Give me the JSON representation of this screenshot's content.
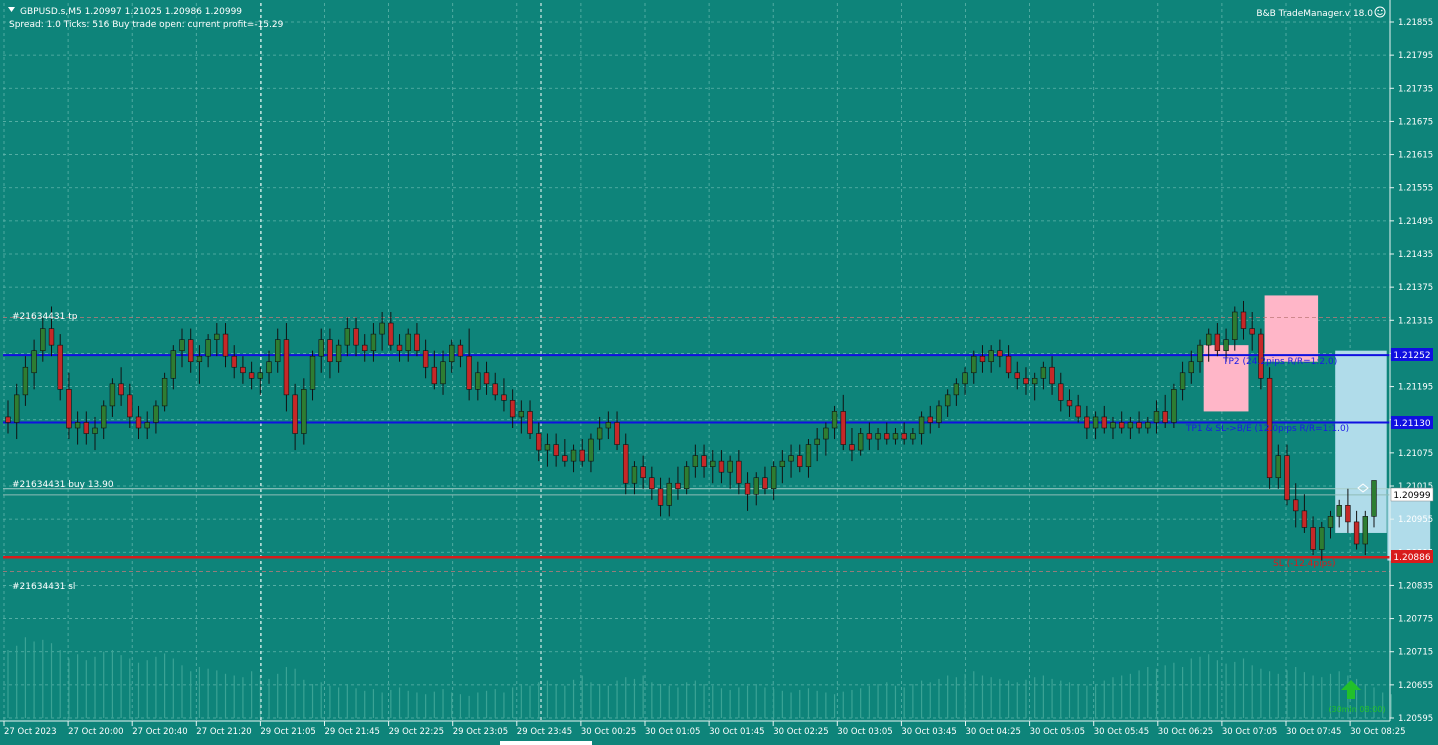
{
  "header": {
    "symbol_line": "GBPUSD.s,M5  1.20997 1.21025 1.20986 1.20999",
    "info_line": "Spread: 1.0   Ticks: 516   Buy trade open: current profit=-15.29",
    "brand": "B&B TradeManager.v 18.0"
  },
  "labels": {
    "tp": "#21634431 tp",
    "buy": "#21634431 buy 13.90",
    "sl": "#21634431 sl",
    "tp2_text": "TP2 (24.2pips R/R=1:2.0)",
    "tp1_text": "TP1 & SL->B/E (12.0pips R/R=1:1.0)",
    "sl_text": "SL (-12.4pips)",
    "countdown": "(30min 08:00)"
  },
  "colors": {
    "background": "#0e847a",
    "grid": "#5fb4ab",
    "bull": "#2e7d32",
    "bear": "#c62828",
    "tp_line": "#1010e0",
    "sl_line": "#d81b1b",
    "volume": "#3ba395",
    "pink_zone": "#ffb6c8",
    "blue_zone": "#b0dcea",
    "arrow": "#22c02a"
  },
  "chart_data": {
    "type": "candlestick",
    "symbol": "GBPUSD.s",
    "timeframe": "M5",
    "ohlc": [
      1.20997,
      1.21025,
      1.20986,
      1.20999
    ],
    "y_ticks": [
      1.21855,
      1.21795,
      1.21735,
      1.21675,
      1.21615,
      1.21555,
      1.21495,
      1.21435,
      1.21375,
      1.21315,
      1.21255,
      1.21195,
      1.21135,
      1.21075,
      1.21015,
      1.20955,
      1.20895,
      1.20835,
      1.20775,
      1.20715,
      1.20655,
      1.20595
    ],
    "x_labels": [
      "27 Oct 2023",
      "27 Oct 20:00",
      "27 Oct 20:40",
      "27 Oct 21:20",
      "29 Oct 21:05",
      "29 Oct 21:45",
      "29 Oct 22:25",
      "29 Oct 23:05",
      "29 Oct 23:45",
      "30 Oct 00:25",
      "30 Oct 01:05",
      "30 Oct 01:45",
      "30 Oct 02:25",
      "30 Oct 03:05",
      "30 Oct 03:45",
      "30 Oct 04:25",
      "30 Oct 05:05",
      "30 Oct 05:45",
      "30 Oct 06:25",
      "30 Oct 07:05",
      "30 Oct 07:45",
      "30 Oct 08:25"
    ],
    "ylim": [
      1.20585,
      1.21885
    ],
    "grid": true,
    "levels": {
      "tp2": {
        "price": "1.21252",
        "value": 1.21252
      },
      "tp1": {
        "price": "1.21130",
        "value": 1.2113
      },
      "bid": {
        "price": "1.20999",
        "value": 1.20999
      },
      "sl": {
        "price": "1.20886",
        "value": 1.20886
      }
    },
    "candles": [
      [
        1.2114,
        1.2117,
        1.2111,
        1.2113
      ],
      [
        1.2113,
        1.212,
        1.211,
        1.2118
      ],
      [
        1.2118,
        1.2125,
        1.2116,
        1.2123
      ],
      [
        1.2122,
        1.2128,
        1.2119,
        1.2126
      ],
      [
        1.2126,
        1.2132,
        1.2124,
        1.213
      ],
      [
        1.213,
        1.2134,
        1.2125,
        1.2127
      ],
      [
        1.2127,
        1.2129,
        1.2117,
        1.2119
      ],
      [
        1.2119,
        1.2122,
        1.211,
        1.2112
      ],
      [
        1.2112,
        1.2115,
        1.2109,
        1.2113
      ],
      [
        1.2113,
        1.2115,
        1.2109,
        1.2111
      ],
      [
        1.2111,
        1.2114,
        1.2108,
        1.2112
      ],
      [
        1.2112,
        1.2117,
        1.211,
        1.2116
      ],
      [
        1.2116,
        1.2121,
        1.2114,
        1.212
      ],
      [
        1.212,
        1.2123,
        1.2116,
        1.2118
      ],
      [
        1.2118,
        1.212,
        1.2112,
        1.2114
      ],
      [
        1.2114,
        1.2116,
        1.211,
        1.2112
      ],
      [
        1.2112,
        1.2115,
        1.211,
        1.2113
      ],
      [
        1.2113,
        1.2117,
        1.2111,
        1.2116
      ],
      [
        1.2116,
        1.2122,
        1.2115,
        1.2121
      ],
      [
        1.2121,
        1.2127,
        1.2119,
        1.2126
      ],
      [
        1.2126,
        1.213,
        1.2123,
        1.2128
      ],
      [
        1.2128,
        1.213,
        1.2122,
        1.2124
      ],
      [
        1.2124,
        1.2127,
        1.212,
        1.2125
      ],
      [
        1.2125,
        1.2129,
        1.2123,
        1.2128
      ],
      [
        1.2128,
        1.2131,
        1.2125,
        1.2129
      ],
      [
        1.2129,
        1.2131,
        1.2123,
        1.2125
      ],
      [
        1.2125,
        1.2127,
        1.2121,
        1.2123
      ],
      [
        1.2123,
        1.2125,
        1.212,
        1.2122
      ],
      [
        1.2122,
        1.2124,
        1.2119,
        1.2121
      ],
      [
        1.2121,
        1.2123,
        1.2118,
        1.2122
      ],
      [
        1.2122,
        1.2126,
        1.212,
        1.2124
      ],
      [
        1.2124,
        1.213,
        1.2122,
        1.2128
      ],
      [
        1.2128,
        1.2131,
        1.2115,
        1.2118
      ],
      [
        1.2118,
        1.212,
        1.2108,
        1.2111
      ],
      [
        1.2111,
        1.2121,
        1.2109,
        1.2119
      ],
      [
        1.2119,
        1.2126,
        1.2117,
        1.2125
      ],
      [
        1.2125,
        1.213,
        1.2122,
        1.2128
      ],
      [
        1.2128,
        1.213,
        1.2121,
        1.2124
      ],
      [
        1.2124,
        1.2128,
        1.2122,
        1.2127
      ],
      [
        1.2127,
        1.2132,
        1.2125,
        1.213
      ],
      [
        1.213,
        1.2132,
        1.2125,
        1.2127
      ],
      [
        1.2127,
        1.2129,
        1.2124,
        1.2126
      ],
      [
        1.2126,
        1.2131,
        1.2124,
        1.2129
      ],
      [
        1.2129,
        1.2133,
        1.2126,
        1.2131
      ],
      [
        1.2131,
        1.2133,
        1.2126,
        1.2127
      ],
      [
        1.2127,
        1.2129,
        1.2124,
        1.2126
      ],
      [
        1.2126,
        1.213,
        1.2124,
        1.2129
      ],
      [
        1.2129,
        1.2131,
        1.2125,
        1.2126
      ],
      [
        1.2126,
        1.2128,
        1.2121,
        1.2123
      ],
      [
        1.2123,
        1.2126,
        1.2119,
        1.212
      ],
      [
        1.212,
        1.2126,
        1.2118,
        1.2124
      ],
      [
        1.2124,
        1.2128,
        1.2122,
        1.2127
      ],
      [
        1.2127,
        1.2128,
        1.2123,
        1.2125
      ],
      [
        1.2125,
        1.213,
        1.2117,
        1.2119
      ],
      [
        1.2119,
        1.2124,
        1.2117,
        1.2122
      ],
      [
        1.2122,
        1.2124,
        1.2118,
        1.212
      ],
      [
        1.212,
        1.2122,
        1.2117,
        1.2118
      ],
      [
        1.2118,
        1.2121,
        1.2115,
        1.2117
      ],
      [
        1.2117,
        1.2119,
        1.2112,
        1.2114
      ],
      [
        1.2114,
        1.2117,
        1.2111,
        1.2115
      ],
      [
        1.2115,
        1.2117,
        1.211,
        1.2111
      ],
      [
        1.2111,
        1.2113,
        1.2106,
        1.2108
      ],
      [
        1.2108,
        1.2111,
        1.2105,
        1.2109
      ],
      [
        1.2109,
        1.2111,
        1.2105,
        1.2107
      ],
      [
        1.2107,
        1.211,
        1.2105,
        1.2106
      ],
      [
        1.2106,
        1.2109,
        1.2104,
        1.2108
      ],
      [
        1.2108,
        1.211,
        1.2105,
        1.2106
      ],
      [
        1.2106,
        1.2111,
        1.2104,
        1.211
      ],
      [
        1.211,
        1.2114,
        1.2108,
        1.2112
      ],
      [
        1.2112,
        1.2115,
        1.211,
        1.2113
      ],
      [
        1.2113,
        1.2115,
        1.2108,
        1.2109
      ],
      [
        1.2109,
        1.2111,
        1.21,
        1.2102
      ],
      [
        1.2102,
        1.2106,
        1.21,
        1.2105
      ],
      [
        1.2105,
        1.2107,
        1.2101,
        1.2103
      ],
      [
        1.2103,
        1.2105,
        1.2099,
        1.2101
      ],
      [
        1.2101,
        1.2103,
        1.2096,
        1.2098
      ],
      [
        1.2098,
        1.2103,
        1.2096,
        1.2102
      ],
      [
        1.2102,
        1.2105,
        1.2099,
        1.2101
      ],
      [
        1.2101,
        1.2106,
        1.21,
        1.2105
      ],
      [
        1.2105,
        1.2109,
        1.2103,
        1.2107
      ],
      [
        1.2107,
        1.2109,
        1.2103,
        1.2105
      ],
      [
        1.2105,
        1.2108,
        1.2102,
        1.2106
      ],
      [
        1.2106,
        1.2108,
        1.2102,
        1.2104
      ],
      [
        1.2104,
        1.2107,
        1.2101,
        1.2106
      ],
      [
        1.2106,
        1.2108,
        1.21,
        1.2102
      ],
      [
        1.2102,
        1.2104,
        1.2097,
        1.21
      ],
      [
        1.21,
        1.2104,
        1.2098,
        1.2103
      ],
      [
        1.2103,
        1.2105,
        1.21,
        1.2101
      ],
      [
        1.2101,
        1.2106,
        1.2099,
        1.2105
      ],
      [
        1.2105,
        1.2108,
        1.2102,
        1.2106
      ],
      [
        1.2106,
        1.2109,
        1.2103,
        1.2107
      ],
      [
        1.2107,
        1.2109,
        1.2104,
        1.2105
      ],
      [
        1.2105,
        1.211,
        1.2103,
        1.2109
      ],
      [
        1.2109,
        1.2112,
        1.2106,
        1.211
      ],
      [
        1.211,
        1.2113,
        1.2107,
        1.2112
      ],
      [
        1.2112,
        1.2116,
        1.211,
        1.2115
      ],
      [
        1.2115,
        1.2118,
        1.2108,
        1.2109
      ],
      [
        1.2109,
        1.2112,
        1.2106,
        1.2108
      ],
      [
        1.2108,
        1.2112,
        1.2107,
        1.2111
      ],
      [
        1.2111,
        1.2113,
        1.2108,
        1.211
      ],
      [
        1.211,
        1.2112,
        1.2108,
        1.2111
      ],
      [
        1.2111,
        1.2113,
        1.2109,
        1.211
      ],
      [
        1.211,
        1.2112,
        1.2109,
        1.2111
      ],
      [
        1.2111,
        1.2113,
        1.2109,
        1.211
      ],
      [
        1.211,
        1.2112,
        1.2109,
        1.2111
      ],
      [
        1.2111,
        1.2115,
        1.2109,
        1.2114
      ],
      [
        1.2114,
        1.2116,
        1.2111,
        1.2113
      ],
      [
        1.2113,
        1.2117,
        1.2112,
        1.2116
      ],
      [
        1.2116,
        1.2119,
        1.2114,
        1.2118
      ],
      [
        1.2118,
        1.2121,
        1.2116,
        1.212
      ],
      [
        1.212,
        1.2123,
        1.2118,
        1.2122
      ],
      [
        1.2122,
        1.2126,
        1.212,
        1.2125
      ],
      [
        1.2125,
        1.2127,
        1.2122,
        1.2124
      ],
      [
        1.2124,
        1.2127,
        1.2122,
        1.2126
      ],
      [
        1.2126,
        1.2128,
        1.2123,
        1.2125
      ],
      [
        1.2125,
        1.2127,
        1.2121,
        1.2122
      ],
      [
        1.2122,
        1.2124,
        1.2119,
        1.2121
      ],
      [
        1.2121,
        1.2123,
        1.2118,
        1.212
      ],
      [
        1.212,
        1.2122,
        1.2117,
        1.2121
      ],
      [
        1.2121,
        1.2124,
        1.2119,
        1.2123
      ],
      [
        1.2123,
        1.2125,
        1.2118,
        1.212
      ],
      [
        1.212,
        1.2122,
        1.2115,
        1.2117
      ],
      [
        1.2117,
        1.2119,
        1.2114,
        1.2116
      ],
      [
        1.2116,
        1.2118,
        1.2113,
        1.2114
      ],
      [
        1.2114,
        1.2116,
        1.211,
        1.2112
      ],
      [
        1.2112,
        1.2115,
        1.211,
        1.2114
      ],
      [
        1.2114,
        1.2116,
        1.2111,
        1.2112
      ],
      [
        1.2112,
        1.2114,
        1.211,
        1.2113
      ],
      [
        1.2113,
        1.2115,
        1.2111,
        1.2112
      ],
      [
        1.2112,
        1.2114,
        1.211,
        1.2113
      ],
      [
        1.2113,
        1.2115,
        1.2111,
        1.2112
      ],
      [
        1.2112,
        1.2114,
        1.2111,
        1.2113
      ],
      [
        1.2113,
        1.2117,
        1.2111,
        1.2115
      ],
      [
        1.2115,
        1.2118,
        1.2112,
        1.2113
      ],
      [
        1.2113,
        1.212,
        1.2112,
        1.2119
      ],
      [
        1.2119,
        1.2124,
        1.2117,
        1.2122
      ],
      [
        1.2122,
        1.2126,
        1.212,
        1.2124
      ],
      [
        1.2124,
        1.2128,
        1.2122,
        1.2127
      ],
      [
        1.2127,
        1.213,
        1.2124,
        1.2129
      ],
      [
        1.2129,
        1.2131,
        1.2125,
        1.2126
      ],
      [
        1.2126,
        1.213,
        1.2124,
        1.2128
      ],
      [
        1.2128,
        1.2134,
        1.2126,
        1.2133
      ],
      [
        1.2133,
        1.2135,
        1.2128,
        1.213
      ],
      [
        1.213,
        1.2133,
        1.2126,
        1.2129
      ],
      [
        1.2129,
        1.213,
        1.2119,
        1.2121
      ],
      [
        1.2121,
        1.2123,
        1.2101,
        1.2103
      ],
      [
        1.2103,
        1.2109,
        1.2101,
        1.2107
      ],
      [
        1.2107,
        1.2109,
        1.2098,
        1.2099
      ],
      [
        1.2099,
        1.2102,
        1.2094,
        1.2097
      ],
      [
        1.2097,
        1.21,
        1.2093,
        1.2094
      ],
      [
        1.2094,
        1.2096,
        1.2089,
        1.209
      ],
      [
        1.209,
        1.2095,
        1.2088,
        1.2094
      ],
      [
        1.2094,
        1.2097,
        1.2092,
        1.2096
      ],
      [
        1.2096,
        1.2099,
        1.2094,
        1.2098
      ],
      [
        1.2098,
        1.2101,
        1.2093,
        1.2095
      ],
      [
        1.2095,
        1.2097,
        1.209,
        1.2091
      ],
      [
        1.2091,
        1.2097,
        1.2089,
        1.2096
      ],
      [
        1.2096,
        1.2101,
        1.2094,
        1.21025
      ]
    ],
    "volumes": [
      0.8,
      0.85,
      0.95,
      0.9,
      0.92,
      0.88,
      0.8,
      0.7,
      0.75,
      0.68,
      0.72,
      0.78,
      0.8,
      0.74,
      0.7,
      0.65,
      0.68,
      0.72,
      0.76,
      0.7,
      0.62,
      0.55,
      0.6,
      0.58,
      0.56,
      0.52,
      0.5,
      0.48,
      0.55,
      0.5,
      0.46,
      0.52,
      0.6,
      0.58,
      0.45,
      0.4,
      0.42,
      0.38,
      0.36,
      0.4,
      0.35,
      0.32,
      0.34,
      0.3,
      0.33,
      0.36,
      0.32,
      0.3,
      0.28,
      0.31,
      0.34,
      0.3,
      0.28,
      0.26,
      0.3,
      0.32,
      0.34,
      0.3,
      0.36,
      0.4,
      0.38,
      0.42,
      0.44,
      0.4,
      0.38,
      0.45,
      0.5,
      0.42,
      0.4,
      0.38,
      0.44,
      0.48,
      0.46,
      0.5,
      0.42,
      0.4,
      0.38,
      0.36,
      0.42,
      0.44,
      0.4,
      0.38,
      0.35,
      0.33,
      0.36,
      0.38,
      0.4,
      0.36,
      0.34,
      0.32,
      0.3,
      0.33,
      0.35,
      0.32,
      0.3,
      0.28,
      0.31,
      0.33,
      0.35,
      0.38,
      0.4,
      0.42,
      0.38,
      0.36,
      0.4,
      0.44,
      0.42,
      0.46,
      0.5,
      0.48,
      0.52,
      0.55,
      0.5,
      0.48,
      0.46,
      0.44,
      0.42,
      0.45,
      0.48,
      0.5,
      0.46,
      0.44,
      0.42,
      0.4,
      0.38,
      0.4,
      0.44,
      0.48,
      0.5,
      0.52,
      0.56,
      0.6,
      0.58,
      0.62,
      0.65,
      0.6,
      0.7,
      0.72,
      0.75,
      0.68,
      0.64,
      0.66,
      0.7,
      0.62,
      0.58,
      0.55,
      0.52,
      0.56,
      0.6,
      0.54,
      0.5,
      0.48,
      0.52,
      0.55,
      0.5,
      0.46,
      0.4,
      0.36,
      0.3,
      0.28
    ]
  }
}
